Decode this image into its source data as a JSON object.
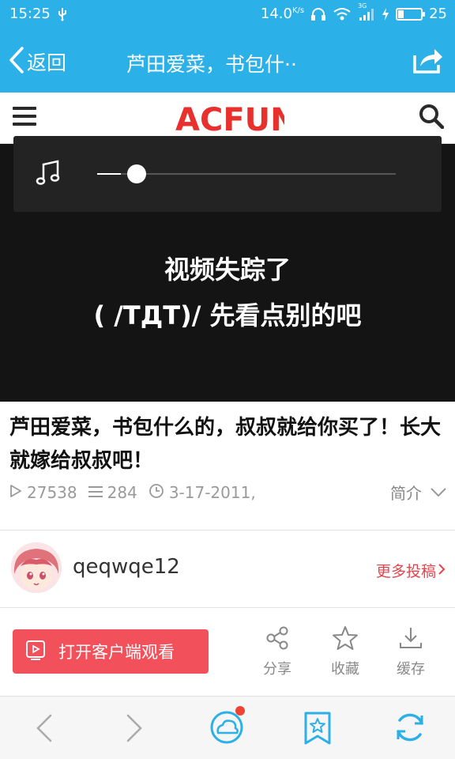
{
  "status_bar": {
    "time": "15:25",
    "network_speed": "14.0",
    "network_unit": "K/s",
    "signal_label": "3G",
    "battery_level": "25",
    "battery_fraction": 0.25
  },
  "header": {
    "back_label": "返回",
    "title": "芦田爱菜，书包什··"
  },
  "site": {
    "logo_text": "ACFUN",
    "accent": "#2cb0e8",
    "brand_red": "#e8302c"
  },
  "player": {
    "progress_fraction": 0.08,
    "missing_line1": "视频失踪了",
    "missing_line2": "( /TДT)/ 先看点别的吧"
  },
  "video": {
    "title": "芦田爱菜，书包什么的，叔叔就给你买了！长大就嫁给叔叔吧！",
    "play_count": "27538",
    "comment_count": "284",
    "date": "3-17-2011,",
    "intro_label": "简介"
  },
  "uploader": {
    "name": "qeqwqe12",
    "more_posts_label": "更多投稿"
  },
  "actions": {
    "open_client_label": "打开客户端观看",
    "share_label": "分享",
    "favorite_label": "收藏",
    "cache_label": "缓存"
  },
  "icons": {
    "back": "chevron-left-icon",
    "share": "share-icon",
    "menu": "hamburger-menu-icon",
    "search": "search-icon",
    "music": "music-note-icon",
    "play": "play-icon",
    "comments": "list-icon",
    "clock": "clock-icon",
    "chevron_down": "chevron-down-icon"
  }
}
